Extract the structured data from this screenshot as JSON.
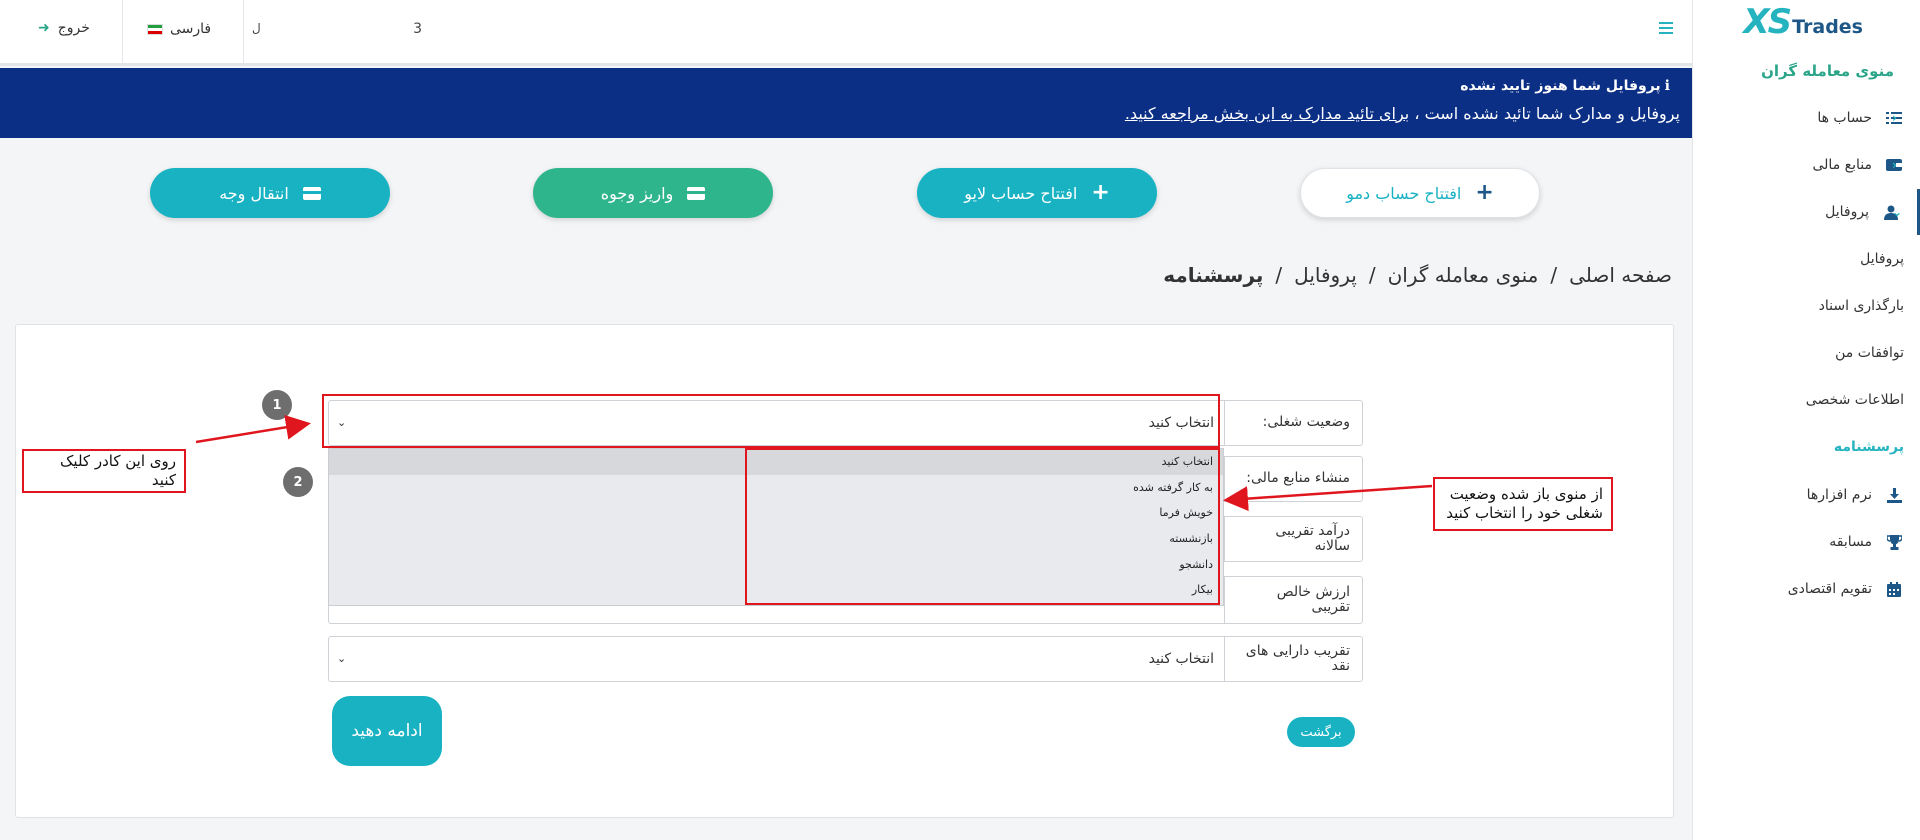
{
  "sidebar": {
    "logo_xs": "XS",
    "logo_trades": "Trades",
    "heading": "منوی معامله گران",
    "items": [
      {
        "label": "حساب ها",
        "icon": "list-icon"
      },
      {
        "label": "منابع مالی",
        "icon": "wallet-icon"
      },
      {
        "label": "پروفایل",
        "icon": "user-icon"
      },
      {
        "label": "نرم افزارها",
        "icon": "download-icon"
      },
      {
        "label": "مسابقه",
        "icon": "trophy-icon"
      },
      {
        "label": "تقویم اقتصادی",
        "icon": "calendar-icon"
      }
    ],
    "subitems": [
      "پروفایل",
      "بارگذاری اسناد",
      "توافقات من",
      "اطلاعات شخصی",
      "پرسشنامه"
    ]
  },
  "topbar": {
    "logout": "خروج",
    "language": "فارسی",
    "account_number": "3",
    "account_suffix": "ل"
  },
  "notice": {
    "title": "پروفایل شما هنوز تایید نشده",
    "text": "پروفایل و مدارک شما تائید نشده است ،",
    "link": "برای تائید مدارک به این بخش مراجعه کنید."
  },
  "actions": {
    "demo": "افتتاح حساب دمو",
    "live": "افتتاح حساب لایو",
    "deposit": "واریز وجوه",
    "transfer": "انتقال وجه"
  },
  "breadcrumb": [
    "صفحه اصلی",
    "منوی معامله گران",
    "پروفایل",
    "پرسشنامه"
  ],
  "form": {
    "fields": [
      {
        "label": "وضعیت شغلی:",
        "value": "انتخاب کنید"
      },
      {
        "label": "منشاء منابع مالی:",
        "value": ""
      },
      {
        "label": "درآمد تقریبی سالانه",
        "value": ""
      },
      {
        "label": "ارزش خالص تقریبی",
        "value": ""
      },
      {
        "label": "تقریب دارایی های نقد",
        "value": "انتخاب کنید"
      }
    ],
    "dropdown_options": [
      "انتخاب کنید",
      "به کار گرفته شده",
      "خویش فرما",
      "بازنشسته",
      "دانشجو",
      "بیکار"
    ],
    "back": "برگشت",
    "continue": "ادامه دهید"
  },
  "annotations": {
    "badge1": "1",
    "badge2": "2",
    "click_note": "روی این کادر کلیک کنید",
    "select_note": "از منوی باز شده وضعیت شغلی خود را انتخاب کنید",
    "color": "#e0161e"
  }
}
